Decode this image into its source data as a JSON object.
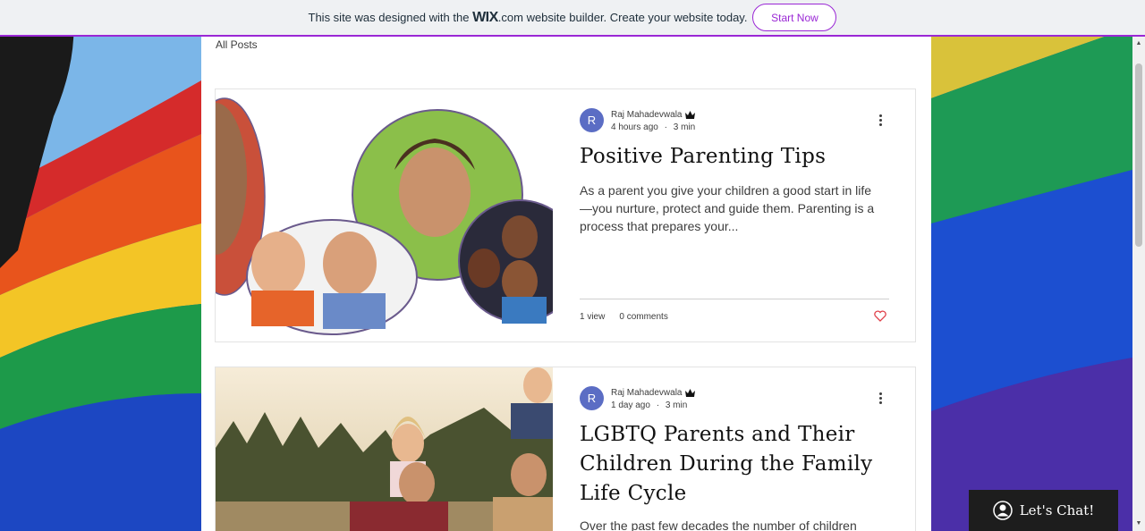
{
  "banner": {
    "text_before": "This site was designed with the ",
    "wix_logo": "WIX",
    "text_after": ".com website builder. Create your website today.",
    "button_label": "Start Now",
    "accent_color": "#9a27d5"
  },
  "feed": {
    "all_posts_label": "All Posts"
  },
  "posts": [
    {
      "avatar_letter": "R",
      "author": "Raj Mahadevwala",
      "author_badge_icon": "crown-icon",
      "time_ago": "4 hours ago",
      "separator": "·",
      "read_time": "3 min",
      "title": "Positive Parenting Tips",
      "excerpt": "As a parent you give your children a good start in life—you nurture, protect and guide them. Parenting is a process that prepares your...",
      "views": "1 view",
      "comments": "0 comments",
      "like_icon": "heart-icon"
    },
    {
      "avatar_letter": "R",
      "author": "Raj Mahadevwala",
      "author_badge_icon": "crown-icon",
      "time_ago": "1 day ago",
      "separator": "·",
      "read_time": "3 min",
      "title": "LGBTQ Parents and Their Children During the Family Life Cycle",
      "excerpt": "Over the past few decades the number of children"
    }
  ],
  "chat": {
    "label": "Let's Chat!",
    "icon": "chat-person-icon"
  }
}
